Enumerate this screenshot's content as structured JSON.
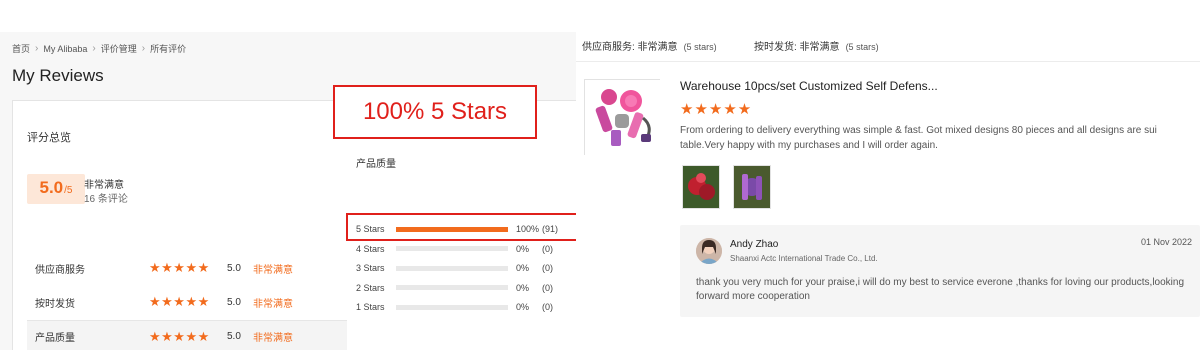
{
  "breadcrumb": [
    "首页",
    "My Alibaba",
    "评价管理",
    "所有评价"
  ],
  "page_title": "My Reviews",
  "overview": {
    "title": "评分总览",
    "score": "5.0",
    "score_max": "/5",
    "satisfaction": "非常满意",
    "review_count": "16 条评论",
    "rows": [
      {
        "label": "供应商服务",
        "stars": "★★★★★",
        "score": "5.0",
        "satisfaction": "非常满意"
      },
      {
        "label": "按时发货",
        "stars": "★★★★★",
        "score": "5.0",
        "satisfaction": "非常满意"
      },
      {
        "label": "产品质量",
        "stars": "★★★★★",
        "score": "5.0",
        "satisfaction": "非常满意"
      }
    ]
  },
  "callout": "100% 5 Stars",
  "quality": {
    "title": "产品质量",
    "distribution": [
      {
        "label": "5 Stars",
        "fraction": 1.0,
        "percent": "100%",
        "count": "(91)"
      },
      {
        "label": "4 Stars",
        "fraction": 0,
        "percent": "0%",
        "count": "(0)"
      },
      {
        "label": "3 Stars",
        "fraction": 0,
        "percent": "0%",
        "count": "(0)"
      },
      {
        "label": "2 Stars",
        "fraction": 0,
        "percent": "0%",
        "count": "(0)"
      },
      {
        "label": "1 Stars",
        "fraction": 0,
        "percent": "0%",
        "count": "(0)"
      }
    ]
  },
  "right_header": {
    "supplier_service": {
      "label": "供应商服务: 非常满意",
      "count": "(5 stars)"
    },
    "on_time": {
      "label": "按时发货: 非常满意",
      "count": "(5 stars)"
    }
  },
  "review": {
    "product_title": "Warehouse 10pcs/set Customized Self Defens...",
    "stars": "★★★★★",
    "text": "From ordering to delivery everything was simple & fast. Got mixed designs 80 pieces and all designs are sui table.Very happy with my purchases and I will order again."
  },
  "reply": {
    "name": "Andy Zhao",
    "company": "Shaanxi Actc International Trade Co., Ltd.",
    "date": "01 Nov 2022",
    "text": "thank you very much for your praise,i will do my best to service everone ,thanks for loving our products,looking forward  more cooperation"
  },
  "colors": {
    "accent": "#f26b1d",
    "highlight_red": "#e0201b",
    "score_bg": "#fde7d8"
  }
}
